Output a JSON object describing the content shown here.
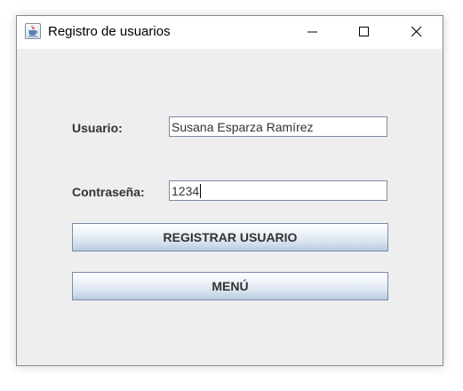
{
  "window": {
    "title": "Registro de usuarios"
  },
  "form": {
    "user_label": "Usuario:",
    "user_value": "Susana Esparza Ramírez",
    "password_label": "Contraseña:",
    "password_value": "1234"
  },
  "buttons": {
    "register_label": "REGISTRAR USUARIO",
    "menu_label": "MENÚ"
  },
  "icons": {
    "app": "java-cup-icon",
    "minimize": "minimize-icon",
    "maximize": "maximize-icon",
    "close": "close-icon"
  },
  "colors": {
    "window_bg": "#eeeeee",
    "titlebar_bg": "#ffffff",
    "button_gradient_top": "#fdfeff",
    "button_gradient_bottom": "#b9cbe0",
    "border": "#7a8aa8",
    "text": "#333333"
  }
}
